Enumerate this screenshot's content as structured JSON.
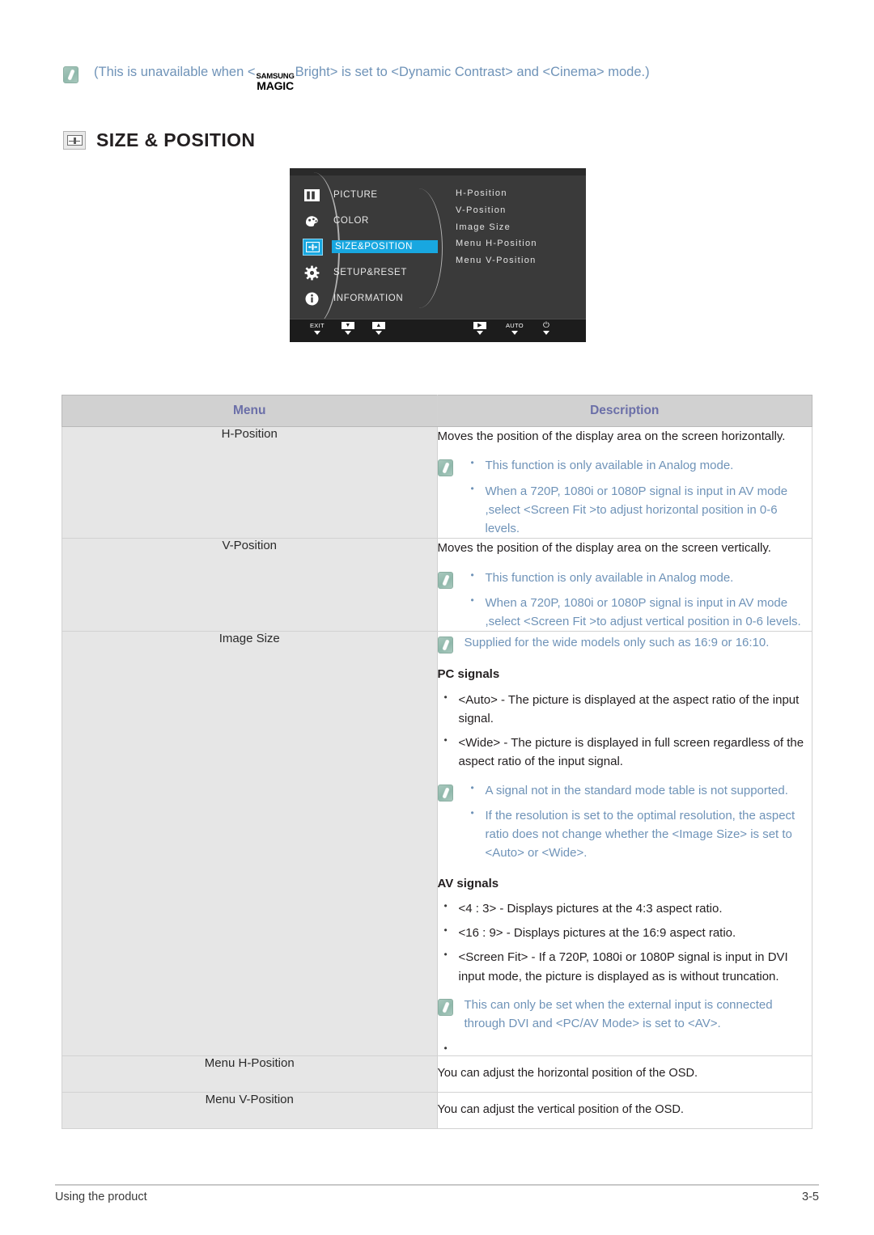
{
  "top_note": {
    "icon": "note-icon",
    "prefix": "(This is unavailable when <",
    "logo_line1": "SAMSUNG",
    "logo_line2": "MAGIC",
    "suffix": "Bright> is set to <Dynamic Contrast> and <Cinema> mode.)"
  },
  "section": {
    "icon": "size-position-icon",
    "title": "SIZE & POSITION"
  },
  "osd": {
    "left_menu": [
      {
        "icon": "picture-icon",
        "label": "PICTURE",
        "active": false
      },
      {
        "icon": "color-icon",
        "label": "COLOR",
        "active": false
      },
      {
        "icon": "size-position-icon",
        "label": "SIZE&POSITION",
        "active": true
      },
      {
        "icon": "setup-reset-icon",
        "label": "SETUP&RESET",
        "active": false
      },
      {
        "icon": "information-icon",
        "label": "INFORMATION",
        "active": false
      }
    ],
    "submenu": [
      "H-Position",
      "V-Position",
      "Image Size",
      "Menu H-Position",
      "Menu V-Position"
    ],
    "buttons": {
      "exit": "EXIT",
      "down": "down-chip",
      "up": "up-chip",
      "enter": "enter-chip",
      "auto": "AUTO",
      "power": "⏻"
    },
    "highlight_color": "#18a7e0"
  },
  "table": {
    "headers": {
      "menu": "Menu",
      "description": "Description"
    },
    "rows": [
      {
        "menu": "H-Position",
        "intro": "Moves the position of the display area on the screen horizontally.",
        "note_bullets": [
          "This function is only available in Analog mode.",
          "When a 720P, 1080i or 1080P signal is input in AV mode ,select <Screen Fit  >to adjust horizontal position in 0-6 levels."
        ]
      },
      {
        "menu": "V-Position",
        "intro": "Moves the position of the display area on the screen vertically.",
        "note_bullets": [
          "This function is only available in Analog mode.",
          "When a 720P, 1080i or 1080P signal is input in AV mode ,select <Screen Fit  >to adjust vertical position in 0-6 levels."
        ]
      },
      {
        "menu": "Image Size",
        "note_top": "Supplied for the wide models only such as 16:9 or 16:10.",
        "pc_heading": "PC signals",
        "pc_bullets": [
          "<Auto> - The picture is displayed at the aspect ratio of the input signal.",
          "<Wide> - The picture is displayed in full screen regardless of the aspect ratio of the input signal."
        ],
        "pc_note_bullets": [
          "A signal not in the standard mode table is not supported.",
          "If the resolution is set to the optimal resolution, the aspect ratio does not change whether the <Image Size> is set to <Auto> or <Wide>."
        ],
        "av_heading": "AV signals",
        "av_bullets": [
          "<4 : 3> - Displays pictures at the 4:3 aspect ratio.",
          "<16 : 9> - Displays pictures at the 16:9 aspect ratio.",
          "<Screen Fit> - If a 720P, 1080i or 1080P signal is input in DVI input mode, the picture is displayed as is without truncation."
        ],
        "av_note": "This can only be set when the external input is connected through DVI and <PC/AV Mode> is set to <AV>."
      },
      {
        "menu": "Menu H-Position",
        "intro": "You can adjust the horizontal position of the OSD."
      },
      {
        "menu": "Menu V-Position",
        "intro": "You can adjust the vertical position of the OSD."
      }
    ]
  },
  "footer": {
    "left": "Using the product",
    "right": "3-5"
  }
}
